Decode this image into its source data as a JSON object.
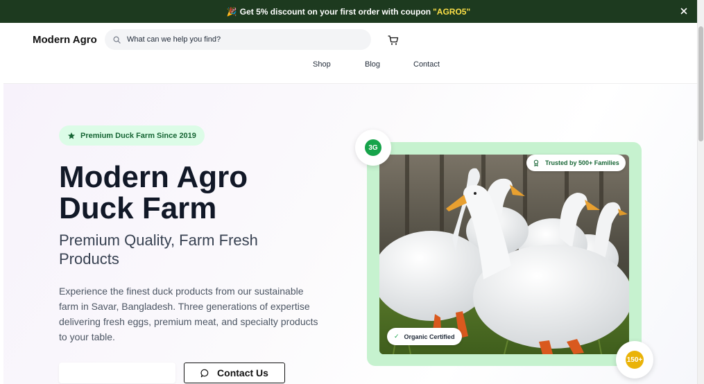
{
  "promo": {
    "emoji": "🎉",
    "text": "Get 5% discount on your first order with coupon",
    "coupon": "\"AGRO5\""
  },
  "header": {
    "brand": "Modern Agro",
    "search_placeholder": "What can we help you find?",
    "nav": [
      "Shop",
      "Blog",
      "Contact"
    ]
  },
  "hero": {
    "badge": "Premium Duck Farm Since 2019",
    "title_line1": "Modern Agro",
    "title_line2": "Duck Farm",
    "subtitle": "Premium Quality, Farm Fresh Products",
    "description": "Experience the finest duck products from our sustainable farm in Savar, Bangladesh. Three generations of expertise delivering fresh eggs, premium meat, and specialty products to your table.",
    "contact_button": "Contact Us"
  },
  "image_card": {
    "trust_label": "Trusted by 500+ Families",
    "organic_label": "Organic Certified",
    "organic_tick": "✓",
    "generations_badge": "3G",
    "families_badge": "150+"
  },
  "colors": {
    "promo_bg": "#1d3a1f",
    "coupon": "#fde047",
    "accent_green": "#16a34a",
    "frame_green": "#c6f2cf",
    "badge_bg": "#dcfce7",
    "gold": "#eab308"
  },
  "icons": [
    "party-popper-icon",
    "close-icon",
    "search-icon",
    "shopping-cart-icon",
    "star-icon",
    "award-icon",
    "check-icon",
    "message-circle-icon"
  ]
}
